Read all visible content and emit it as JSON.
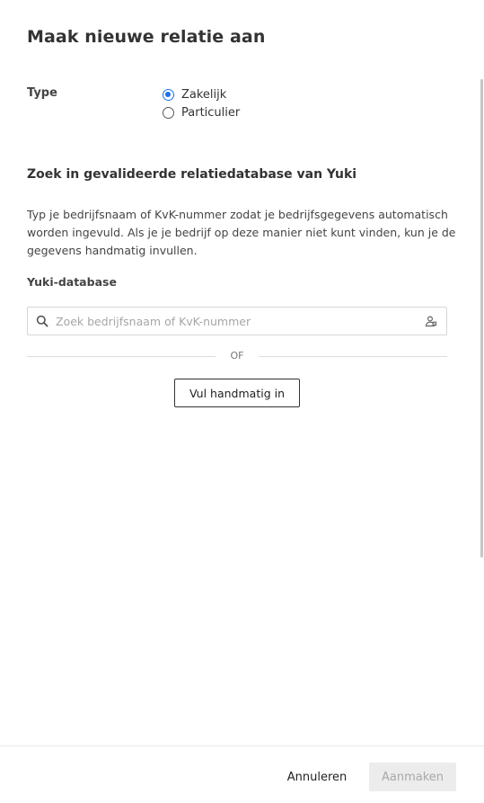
{
  "dialog": {
    "title": "Maak nieuwe relatie aan"
  },
  "type_field": {
    "label": "Type",
    "options": [
      {
        "label": "Zakelijk",
        "selected": true
      },
      {
        "label": "Particulier",
        "selected": false
      }
    ]
  },
  "lookup": {
    "heading": "Zoek in gevalideerde relatiedatabase van Yuki",
    "description": "Typ je bedrijfsnaam of KvK-nummer zodat je bedrijfsgegevens automatisch worden ingevuld. Als je je bedrijf op deze manier niet kunt vinden, kun je de gegevens handmatig invullen.",
    "database_label": "Yuki-database",
    "search": {
      "value": "",
      "placeholder": "Zoek bedrijfsnaam of KvK-nummer",
      "left_icon": "search-icon",
      "right_icon": "contact-card-icon"
    },
    "divider_text": "OF",
    "manual_button_label": "Vul handmatig in"
  },
  "footer": {
    "cancel_label": "Annuleren",
    "create_label": "Aanmaken",
    "create_enabled": false
  },
  "colors": {
    "accent": "#1a73e8",
    "disabled_bg": "#ececec",
    "disabled_text": "#a8a8a8"
  }
}
